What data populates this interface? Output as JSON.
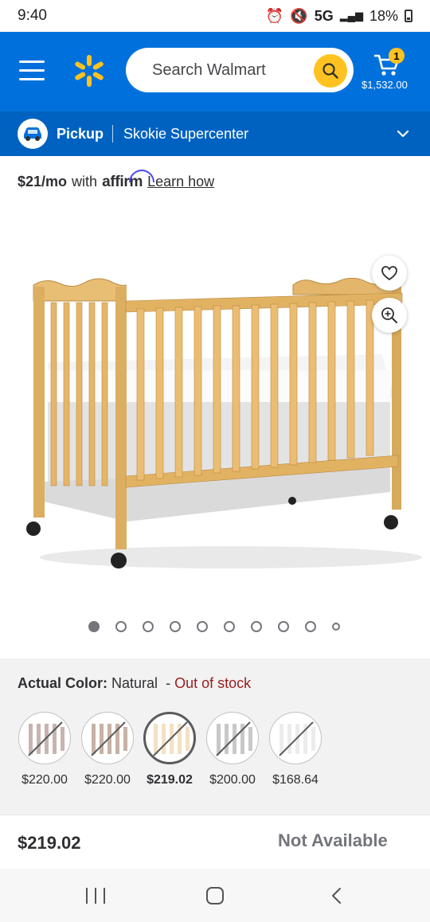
{
  "status_bar": {
    "time": "9:40",
    "network": "5G",
    "battery": "18%"
  },
  "header": {
    "search_placeholder": "Search Walmart",
    "cart_count": "1",
    "cart_total": "$1,532.00",
    "brand_color": "#0071dc",
    "accent_color": "#ffc220"
  },
  "pickup": {
    "label": "Pickup",
    "store": "Skokie Supercenter"
  },
  "affirm": {
    "amount": "$21/mo",
    "with": "with",
    "brand": "affirm",
    "link": "Learn how"
  },
  "gallery": {
    "image_count": 10,
    "active_index": 0
  },
  "color_section": {
    "label": "Actual Color:",
    "value": "Natural",
    "separator": "-",
    "stock": "Out of stock",
    "options": [
      {
        "price": "$220.00",
        "tone": "#c9b3ae",
        "selected": false
      },
      {
        "price": "$220.00",
        "tone": "#c7b2a5",
        "selected": false
      },
      {
        "price": "$219.02",
        "tone": "#f3e1c3",
        "selected": true
      },
      {
        "price": "$200.00",
        "tone": "#c8c8c8",
        "selected": false
      },
      {
        "price": "$168.64",
        "tone": "#ececec",
        "selected": false
      }
    ]
  },
  "purchase": {
    "price": "$219.02",
    "availability": "Not Available"
  }
}
